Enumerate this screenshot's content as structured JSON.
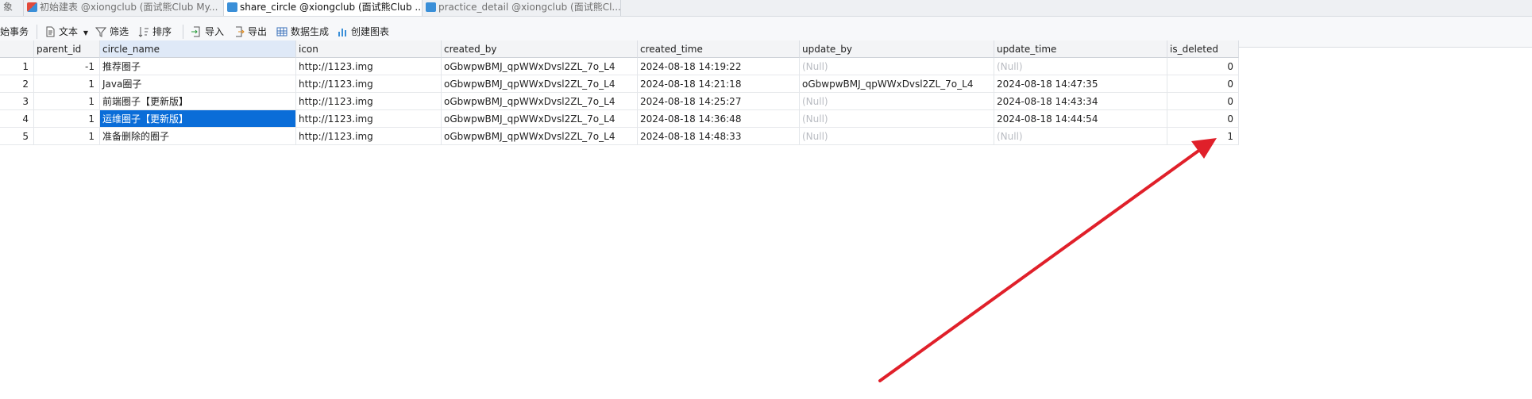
{
  "tabs": [
    {
      "label": "象",
      "icon": "",
      "active": false
    },
    {
      "label": "初始建表 @xiongclub (面试熊Club My...",
      "icon": "table-design-icon",
      "active": false
    },
    {
      "label": "share_circle @xiongclub (面试熊Club ...",
      "icon": "table-icon",
      "active": true
    },
    {
      "label": "practice_detail @xiongclub (面试熊Cl...",
      "icon": "table-icon",
      "active": false
    }
  ],
  "toolbar": {
    "begin_tx": "始事务",
    "text": "文本",
    "filter": "筛选",
    "sort": "排序",
    "import": "导入",
    "export": "导出",
    "datagen": "数据生成",
    "chart": "创建图表"
  },
  "columns": [
    "parent_id",
    "circle_name",
    "icon",
    "created_by",
    "created_time",
    "update_by",
    "update_time",
    "is_deleted"
  ],
  "rows": [
    {
      "id": "1",
      "parent_id": "-1",
      "circle_name": "推荐圈子",
      "icon": "http://1123.img",
      "created_by": "oGbwpwBMJ_qpWWxDvsl2ZL_7o_L4",
      "created_time": "2024-08-18 14:19:22",
      "update_by": "(Null)",
      "update_time": "(Null)",
      "is_deleted": "0"
    },
    {
      "id": "2",
      "parent_id": "1",
      "circle_name": "Java圈子",
      "icon": "http://1123.img",
      "created_by": "oGbwpwBMJ_qpWWxDvsl2ZL_7o_L4",
      "created_time": "2024-08-18 14:21:18",
      "update_by": "oGbwpwBMJ_qpWWxDvsl2ZL_7o_L4",
      "update_time": "2024-08-18 14:47:35",
      "is_deleted": "0"
    },
    {
      "id": "3",
      "parent_id": "1",
      "circle_name": "前端圈子【更新版】",
      "icon": "http://1123.img",
      "created_by": "oGbwpwBMJ_qpWWxDvsl2ZL_7o_L4",
      "created_time": "2024-08-18 14:25:27",
      "update_by": "(Null)",
      "update_time": "2024-08-18 14:43:34",
      "is_deleted": "0"
    },
    {
      "id": "4",
      "parent_id": "1",
      "circle_name": "运维圈子【更新版】",
      "icon": "http://1123.img",
      "created_by": "oGbwpwBMJ_qpWWxDvsl2ZL_7o_L4",
      "created_time": "2024-08-18 14:36:48",
      "update_by": "(Null)",
      "update_time": "2024-08-18 14:44:54",
      "is_deleted": "0"
    },
    {
      "id": "5",
      "parent_id": "1",
      "circle_name": "准备删除的圈子",
      "icon": "http://1123.img",
      "created_by": "oGbwpwBMJ_qpWWxDvsl2ZL_7o_L4",
      "created_time": "2024-08-18 14:48:33",
      "update_by": "(Null)",
      "update_time": "(Null)",
      "is_deleted": "1"
    }
  ],
  "selection": {
    "row": 4,
    "column": "circle_name"
  },
  "annotation": {
    "type": "arrow",
    "color": "#e0202a",
    "points_to": "is_deleted of row 5"
  },
  "colors": {
    "selected_cell": "#0a6dd8",
    "null_text": "#b9bcc2",
    "annotation_arrow": "#e0202a"
  }
}
